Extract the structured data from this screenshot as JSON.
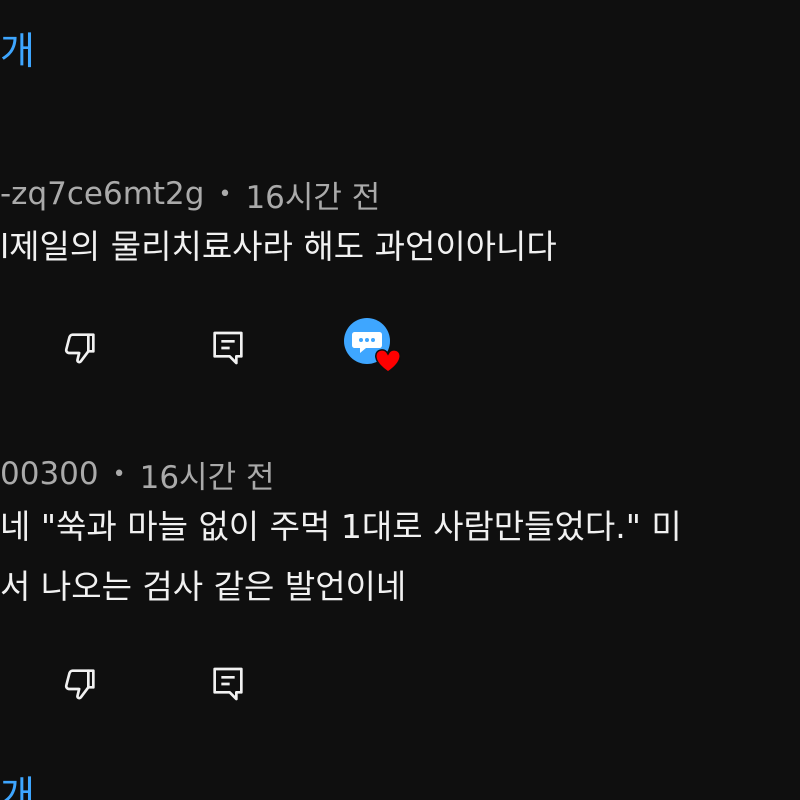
{
  "replies_link_top": "개",
  "replies_link_bottom": "개",
  "comments": [
    {
      "author": "-zq7ce6mt2g",
      "time": "16시간 전",
      "lines": [
        "l제일의 물리치료사라 해도 과언이아니다"
      ],
      "creator_heart": true
    },
    {
      "author": "00300",
      "time": "16시간 전",
      "lines": [
        "네 \"쑥과 마늘 없이 주먹 1대로 사람만들었다.\" 미",
        "서 나오는 검사 같은 발언이네"
      ],
      "creator_heart": false
    }
  ],
  "icons": {
    "dislike": "thumbs-down-icon",
    "reply": "comment-reply-icon",
    "creator_heart": "creator-heart-icon"
  },
  "colors": {
    "background": "#0f0f0f",
    "link": "#3ea6ff",
    "meta_text": "#aaaaaa",
    "body_text": "#f1f1f1",
    "heart": "#ff0000",
    "avatar_badge": "#3ea6ff"
  }
}
